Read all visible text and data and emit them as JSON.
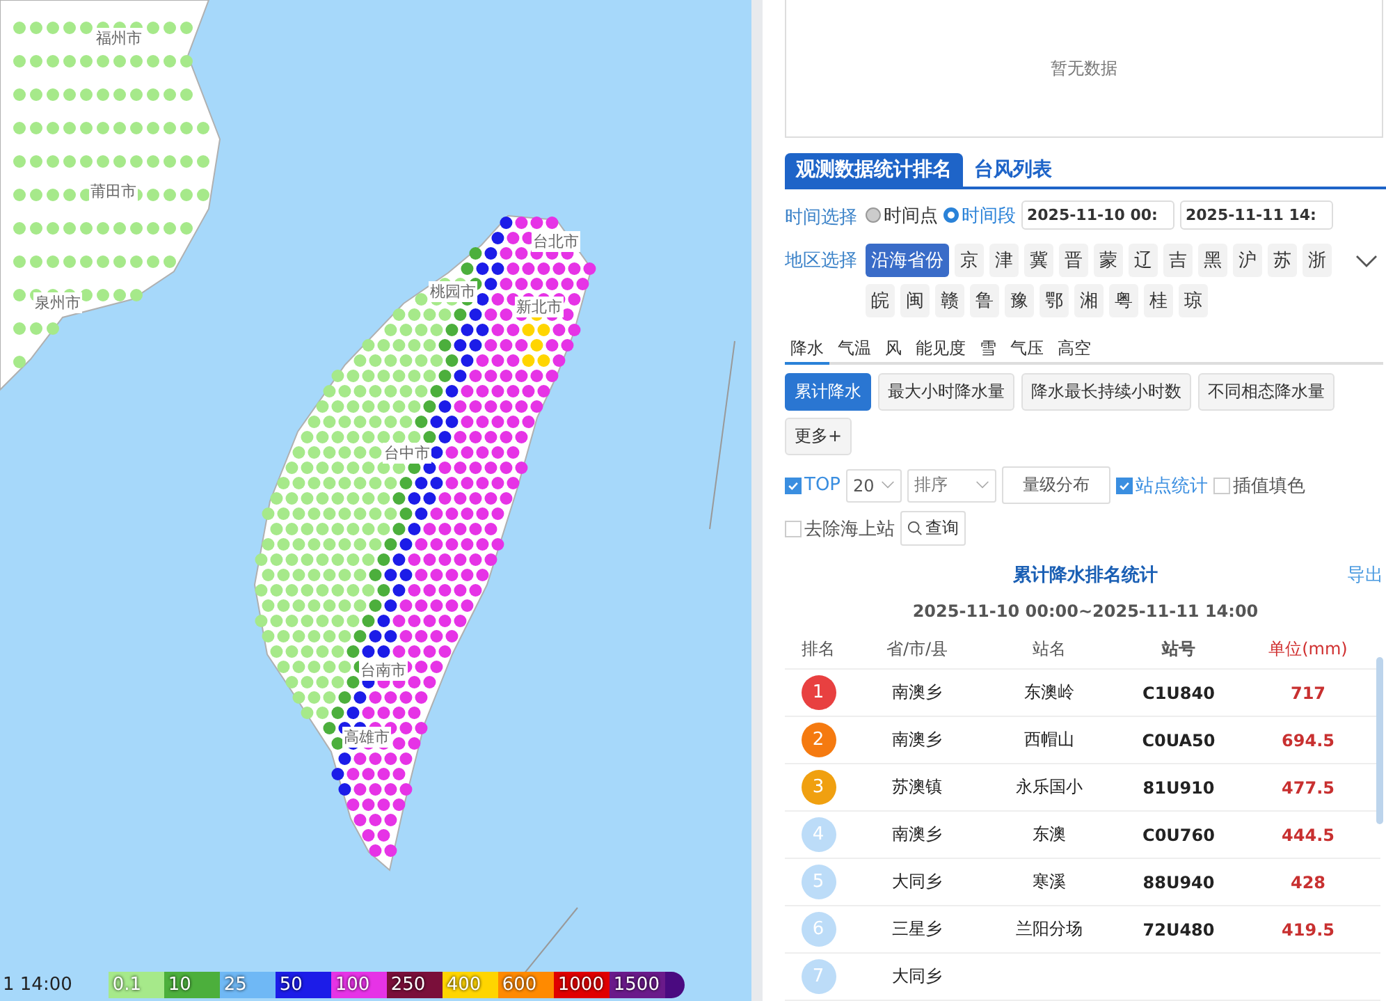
{
  "map": {
    "city_labels": [
      "福州市",
      "莆田市",
      "泉州市",
      "台北市",
      "桃园市",
      "新北市",
      "台中市",
      "台南市",
      "高雄市"
    ],
    "time_label": "1 14:00",
    "legend": [
      {
        "label": "0.1",
        "color": "#a6e98a"
      },
      {
        "label": "10",
        "color": "#4caf3c"
      },
      {
        "label": "25",
        "color": "#6fb8f5"
      },
      {
        "label": "50",
        "color": "#1c1ce8"
      },
      {
        "label": "100",
        "color": "#e633e6"
      },
      {
        "label": "250",
        "color": "#7a0f3a"
      },
      {
        "label": "400",
        "color": "#ffd500"
      },
      {
        "label": "600",
        "color": "#ff8a00"
      },
      {
        "label": "1000",
        "color": "#e00000"
      },
      {
        "label": "1500",
        "color": "#6a1a8a"
      }
    ]
  },
  "panel": {
    "empty_text": "暂无数据",
    "tabs": [
      {
        "label": "观测数据统计排名",
        "selected": true
      },
      {
        "label": "台风列表",
        "selected": false
      }
    ],
    "time": {
      "label": "时间选择",
      "options": [
        {
          "label": "时间点",
          "selected": false
        },
        {
          "label": "时间段",
          "selected": true
        }
      ],
      "start": "2025-11-10 00:",
      "end": "2025-11-11 14:"
    },
    "region": {
      "label": "地区选择",
      "items": [
        {
          "label": "沿海省份",
          "selected": true
        },
        {
          "label": "京",
          "selected": false
        },
        {
          "label": "津",
          "selected": false
        },
        {
          "label": "冀",
          "selected": false
        },
        {
          "label": "晋",
          "selected": false
        },
        {
          "label": "蒙",
          "selected": false
        },
        {
          "label": "辽",
          "selected": false
        },
        {
          "label": "吉",
          "selected": false
        },
        {
          "label": "黑",
          "selected": false
        },
        {
          "label": "沪",
          "selected": false
        },
        {
          "label": "苏",
          "selected": false
        },
        {
          "label": "浙",
          "selected": false
        },
        {
          "label": "皖",
          "selected": false
        },
        {
          "label": "闽",
          "selected": false
        },
        {
          "label": "赣",
          "selected": false
        },
        {
          "label": "鲁",
          "selected": false
        },
        {
          "label": "豫",
          "selected": false
        },
        {
          "label": "鄂",
          "selected": false
        },
        {
          "label": "湘",
          "selected": false
        },
        {
          "label": "粤",
          "selected": false
        },
        {
          "label": "桂",
          "selected": false
        },
        {
          "label": "琼",
          "selected": false
        }
      ]
    },
    "element_tabs": [
      {
        "label": "降水",
        "selected": true
      },
      {
        "label": "气温",
        "selected": false
      },
      {
        "label": "风",
        "selected": false
      },
      {
        "label": "能见度",
        "selected": false
      },
      {
        "label": "雪",
        "selected": false
      },
      {
        "label": "气压",
        "selected": false
      },
      {
        "label": "高空",
        "selected": false
      }
    ],
    "stat_buttons": [
      {
        "label": "累计降水",
        "selected": true
      },
      {
        "label": "最大小时降水量",
        "selected": false
      },
      {
        "label": "降水最长持续小时数",
        "selected": false
      },
      {
        "label": "不同相态降水量",
        "selected": false
      },
      {
        "label": "更多+",
        "selected": false
      }
    ],
    "top": {
      "label": "TOP",
      "checked": true
    },
    "top_count": "20",
    "sort_placeholder": "排序",
    "level_button": "量级分布",
    "checks": [
      {
        "label": "站点统计",
        "checked": true
      },
      {
        "label": "插值填色",
        "checked": false
      },
      {
        "label": "去除海上站",
        "checked": false
      }
    ],
    "query_button": "查询",
    "table": {
      "title": "累计降水排名统计",
      "export": "导出",
      "range": "2025-11-10 00:00~2025-11-11 14:00",
      "columns": [
        "排名",
        "省/市/县",
        "站名",
        "站号",
        "单位(mm)"
      ],
      "rows": [
        {
          "rank": "1",
          "color": "#e84040",
          "district": "南澳乡",
          "station": "东澳岭",
          "id": "C1U840",
          "value": "717"
        },
        {
          "rank": "2",
          "color": "#f57a10",
          "district": "南澳乡",
          "station": "西帽山",
          "id": "C0UA50",
          "value": "694.5"
        },
        {
          "rank": "3",
          "color": "#f0a010",
          "district": "苏澳镇",
          "station": "永乐国小",
          "id": "81U910",
          "value": "477.5"
        },
        {
          "rank": "4",
          "color": "#bcdcf8",
          "district": "南澳乡",
          "station": "东澳",
          "id": "C0U760",
          "value": "444.5"
        },
        {
          "rank": "5",
          "color": "#bcdcf8",
          "district": "大同乡",
          "station": "寒溪",
          "id": "88U940",
          "value": "428"
        },
        {
          "rank": "6",
          "color": "#bcdcf8",
          "district": "三星乡",
          "station": "兰阳分场",
          "id": "72U480",
          "value": "419.5"
        },
        {
          "rank": "7",
          "color": "#bcdcf8",
          "district": "大同乡"
        }
      ]
    }
  }
}
